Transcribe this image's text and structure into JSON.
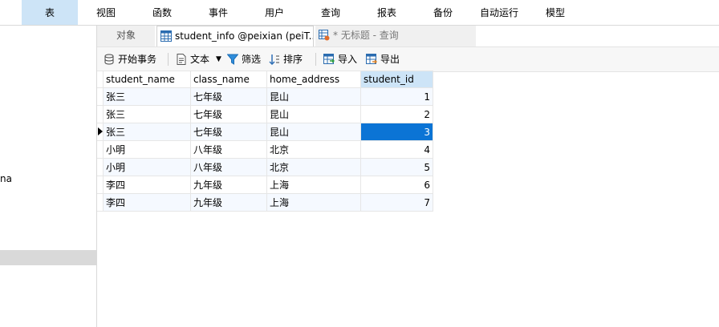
{
  "menu": {
    "items": [
      {
        "label": "表",
        "active": true
      },
      {
        "label": "视图"
      },
      {
        "label": "函数"
      },
      {
        "label": "事件"
      },
      {
        "label": "用户"
      },
      {
        "label": "查询"
      },
      {
        "label": "报表"
      },
      {
        "label": "备份"
      },
      {
        "label": "自动运行"
      },
      {
        "label": "模型"
      }
    ]
  },
  "left_panel": {
    "text_fragment": "na"
  },
  "tabs": {
    "objects": "对象",
    "active": "student_info @peixian (peiT...",
    "query": "* 无标题 - 查询"
  },
  "toolbar": {
    "begin_transaction": "开始事务",
    "text": "文本",
    "filter": "筛选",
    "sort": "排序",
    "import": "导入",
    "export": "导出"
  },
  "grid": {
    "columns": [
      "student_name",
      "class_name",
      "home_address",
      "student_id"
    ],
    "rows": [
      [
        "张三",
        "七年级",
        "昆山",
        "1"
      ],
      [
        "张三",
        "七年级",
        "昆山",
        "2"
      ],
      [
        "张三",
        "七年级",
        "昆山",
        "3"
      ],
      [
        "小明",
        "八年级",
        "北京",
        "4"
      ],
      [
        "小明",
        "八年级",
        "北京",
        "5"
      ],
      [
        "李四",
        "九年级",
        "上海",
        "6"
      ],
      [
        "李四",
        "九年级",
        "上海",
        "7"
      ]
    ],
    "current_row_index": 2,
    "selected_cell_color": "#0b74d5"
  },
  "colors": {
    "active_menu": "#cde4f7",
    "selected_header": "#cde4f7",
    "accent": "#0b74d5"
  }
}
